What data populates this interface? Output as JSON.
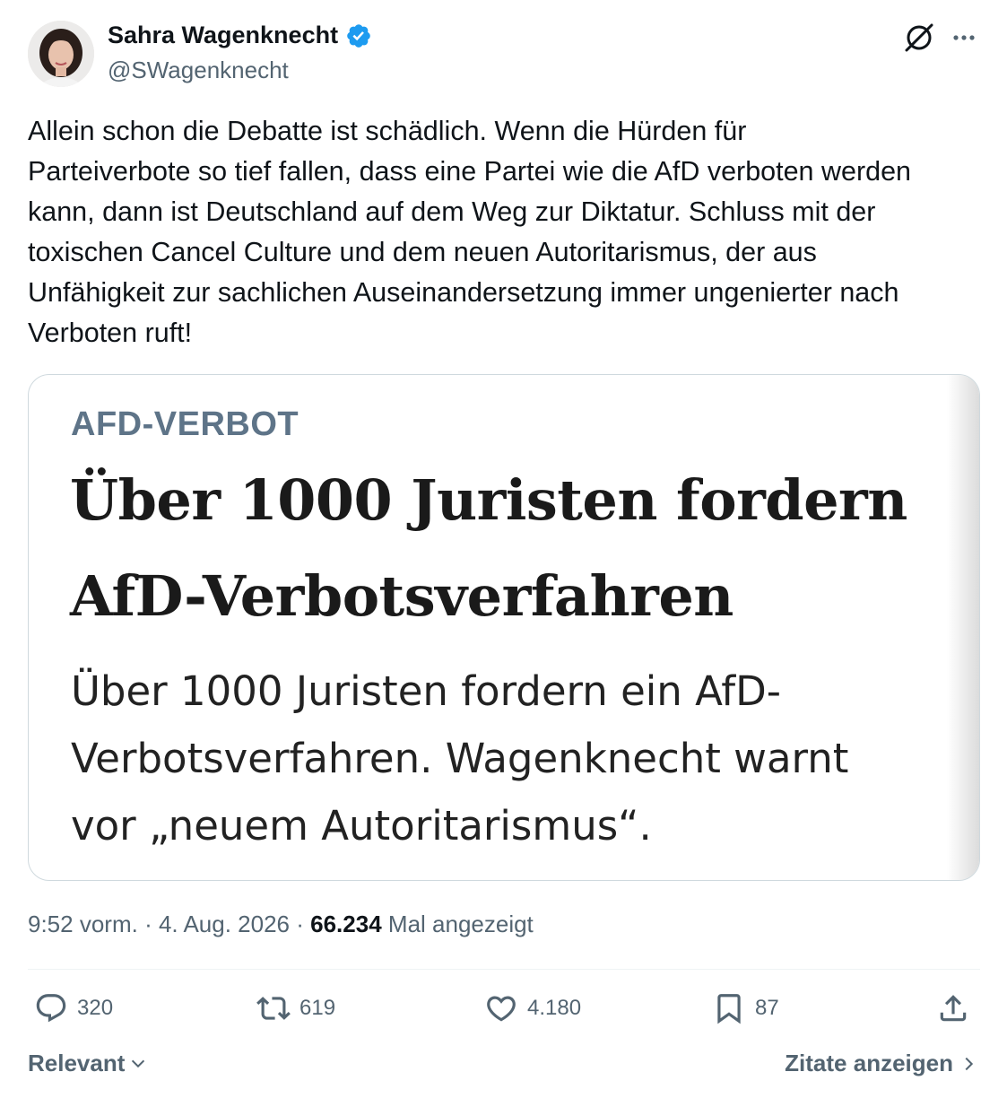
{
  "author": {
    "display_name": "Sahra Wagenknecht",
    "handle": "@SWagenknecht",
    "verified_color": "#1d9bf0"
  },
  "icons": {
    "avatar": "profile-photo",
    "verified": "verified-badge-icon",
    "grok": "grok-icon",
    "more": "more-icon",
    "reply": "reply-icon",
    "retweet": "retweet-icon",
    "like": "heart-icon",
    "bookmark": "bookmark-icon",
    "share": "share-icon",
    "chevron_down": "chevron-down-icon",
    "chevron_right": "chevron-right-icon"
  },
  "tweet": {
    "text": "Allein schon die Debatte ist schädlich. Wenn die Hürden für\nParteiverbote so tief fallen, dass eine Partei wie die AfD verboten werden\nkann, dann ist Deutschland auf dem Weg zur Diktatur. Schluss mit der\ntoxischen Cancel Culture und dem neuen Autoritarismus, der aus\nUnfähigkeit zur sachlichen Auseinandersetzung immer ungenierter nach\nVerboten ruft!"
  },
  "media": {
    "kicker": "AFD-VERBOT",
    "headline": "Über 1000 Juristen fordern\nAfD-Verbotsverfahren",
    "teaser": "Über 1000 Juristen fordern ein AfD-\nVerbotsverfahren. Wagenknecht warnt\nvor „neuem Autoritarismus“."
  },
  "meta": {
    "time": "9:52 vorm.",
    "separator": "·",
    "date": "4. Aug. 2026",
    "views_count": "66.234",
    "views_label": "Mal angezeigt"
  },
  "actions": {
    "replies": "320",
    "retweets": "619",
    "likes": "4.180",
    "bookmarks": "87"
  },
  "footer": {
    "sort_label": "Relevant",
    "quotes_label": "Zitate anzeigen"
  }
}
